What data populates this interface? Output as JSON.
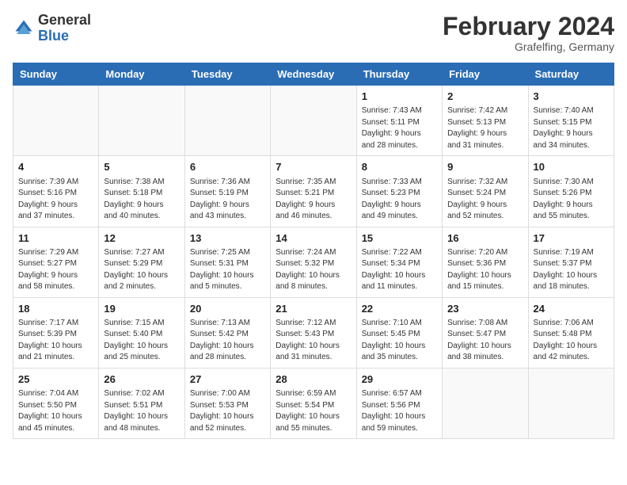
{
  "header": {
    "logo_general": "General",
    "logo_blue": "Blue",
    "month_title": "February 2024",
    "location": "Grafelfing, Germany"
  },
  "columns": [
    "Sunday",
    "Monday",
    "Tuesday",
    "Wednesday",
    "Thursday",
    "Friday",
    "Saturday"
  ],
  "weeks": [
    [
      {
        "day": "",
        "info": ""
      },
      {
        "day": "",
        "info": ""
      },
      {
        "day": "",
        "info": ""
      },
      {
        "day": "",
        "info": ""
      },
      {
        "day": "1",
        "info": "Sunrise: 7:43 AM\nSunset: 5:11 PM\nDaylight: 9 hours\nand 28 minutes."
      },
      {
        "day": "2",
        "info": "Sunrise: 7:42 AM\nSunset: 5:13 PM\nDaylight: 9 hours\nand 31 minutes."
      },
      {
        "day": "3",
        "info": "Sunrise: 7:40 AM\nSunset: 5:15 PM\nDaylight: 9 hours\nand 34 minutes."
      }
    ],
    [
      {
        "day": "4",
        "info": "Sunrise: 7:39 AM\nSunset: 5:16 PM\nDaylight: 9 hours\nand 37 minutes."
      },
      {
        "day": "5",
        "info": "Sunrise: 7:38 AM\nSunset: 5:18 PM\nDaylight: 9 hours\nand 40 minutes."
      },
      {
        "day": "6",
        "info": "Sunrise: 7:36 AM\nSunset: 5:19 PM\nDaylight: 9 hours\nand 43 minutes."
      },
      {
        "day": "7",
        "info": "Sunrise: 7:35 AM\nSunset: 5:21 PM\nDaylight: 9 hours\nand 46 minutes."
      },
      {
        "day": "8",
        "info": "Sunrise: 7:33 AM\nSunset: 5:23 PM\nDaylight: 9 hours\nand 49 minutes."
      },
      {
        "day": "9",
        "info": "Sunrise: 7:32 AM\nSunset: 5:24 PM\nDaylight: 9 hours\nand 52 minutes."
      },
      {
        "day": "10",
        "info": "Sunrise: 7:30 AM\nSunset: 5:26 PM\nDaylight: 9 hours\nand 55 minutes."
      }
    ],
    [
      {
        "day": "11",
        "info": "Sunrise: 7:29 AM\nSunset: 5:27 PM\nDaylight: 9 hours\nand 58 minutes."
      },
      {
        "day": "12",
        "info": "Sunrise: 7:27 AM\nSunset: 5:29 PM\nDaylight: 10 hours\nand 2 minutes."
      },
      {
        "day": "13",
        "info": "Sunrise: 7:25 AM\nSunset: 5:31 PM\nDaylight: 10 hours\nand 5 minutes."
      },
      {
        "day": "14",
        "info": "Sunrise: 7:24 AM\nSunset: 5:32 PM\nDaylight: 10 hours\nand 8 minutes."
      },
      {
        "day": "15",
        "info": "Sunrise: 7:22 AM\nSunset: 5:34 PM\nDaylight: 10 hours\nand 11 minutes."
      },
      {
        "day": "16",
        "info": "Sunrise: 7:20 AM\nSunset: 5:36 PM\nDaylight: 10 hours\nand 15 minutes."
      },
      {
        "day": "17",
        "info": "Sunrise: 7:19 AM\nSunset: 5:37 PM\nDaylight: 10 hours\nand 18 minutes."
      }
    ],
    [
      {
        "day": "18",
        "info": "Sunrise: 7:17 AM\nSunset: 5:39 PM\nDaylight: 10 hours\nand 21 minutes."
      },
      {
        "day": "19",
        "info": "Sunrise: 7:15 AM\nSunset: 5:40 PM\nDaylight: 10 hours\nand 25 minutes."
      },
      {
        "day": "20",
        "info": "Sunrise: 7:13 AM\nSunset: 5:42 PM\nDaylight: 10 hours\nand 28 minutes."
      },
      {
        "day": "21",
        "info": "Sunrise: 7:12 AM\nSunset: 5:43 PM\nDaylight: 10 hours\nand 31 minutes."
      },
      {
        "day": "22",
        "info": "Sunrise: 7:10 AM\nSunset: 5:45 PM\nDaylight: 10 hours\nand 35 minutes."
      },
      {
        "day": "23",
        "info": "Sunrise: 7:08 AM\nSunset: 5:47 PM\nDaylight: 10 hours\nand 38 minutes."
      },
      {
        "day": "24",
        "info": "Sunrise: 7:06 AM\nSunset: 5:48 PM\nDaylight: 10 hours\nand 42 minutes."
      }
    ],
    [
      {
        "day": "25",
        "info": "Sunrise: 7:04 AM\nSunset: 5:50 PM\nDaylight: 10 hours\nand 45 minutes."
      },
      {
        "day": "26",
        "info": "Sunrise: 7:02 AM\nSunset: 5:51 PM\nDaylight: 10 hours\nand 48 minutes."
      },
      {
        "day": "27",
        "info": "Sunrise: 7:00 AM\nSunset: 5:53 PM\nDaylight: 10 hours\nand 52 minutes."
      },
      {
        "day": "28",
        "info": "Sunrise: 6:59 AM\nSunset: 5:54 PM\nDaylight: 10 hours\nand 55 minutes."
      },
      {
        "day": "29",
        "info": "Sunrise: 6:57 AM\nSunset: 5:56 PM\nDaylight: 10 hours\nand 59 minutes."
      },
      {
        "day": "",
        "info": ""
      },
      {
        "day": "",
        "info": ""
      }
    ]
  ]
}
